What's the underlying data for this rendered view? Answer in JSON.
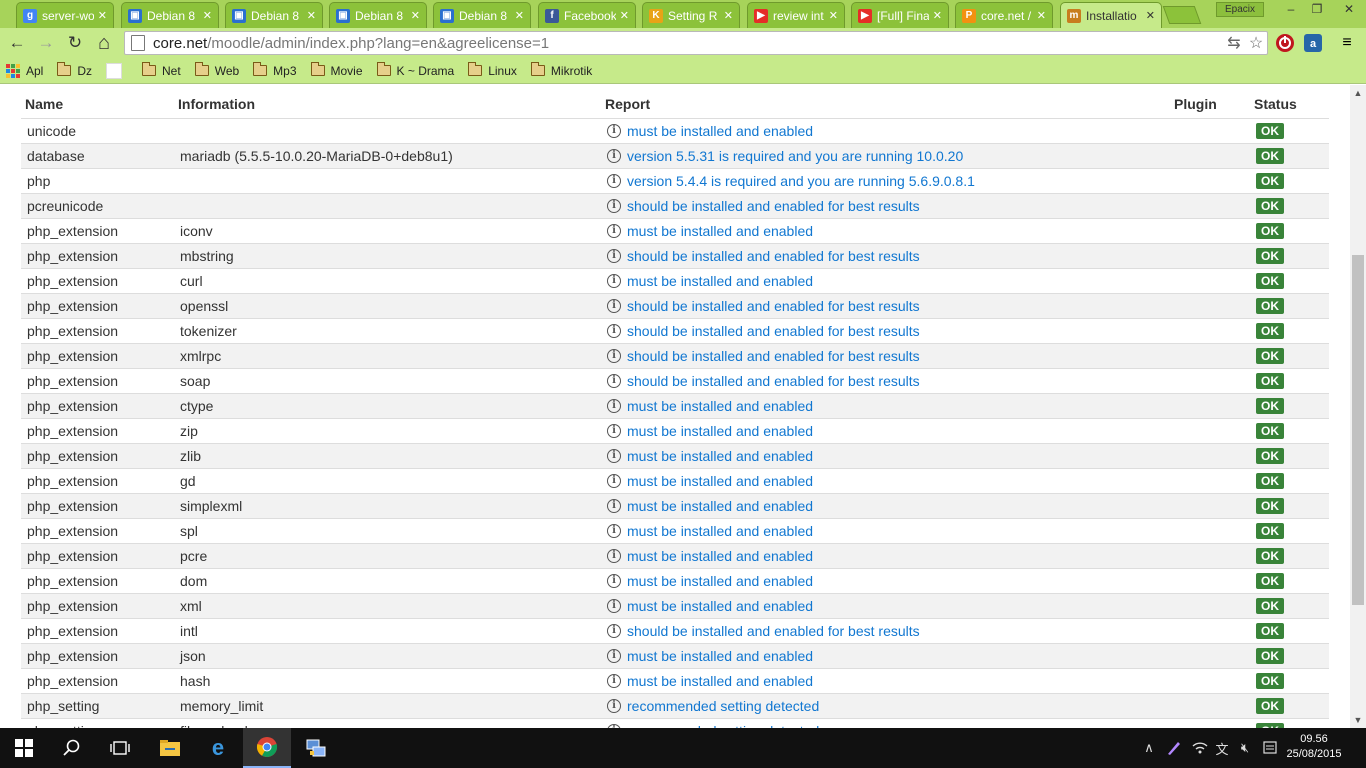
{
  "browser": {
    "tabs": [
      {
        "title": "server-wo",
        "color": "#4285f4",
        "glyph": "g"
      },
      {
        "title": "Debian 8",
        "color": "#2a6fcf",
        "glyph": "▣"
      },
      {
        "title": "Debian 8",
        "color": "#2a6fcf",
        "glyph": "▣"
      },
      {
        "title": "Debian 8",
        "color": "#2a6fcf",
        "glyph": "▣"
      },
      {
        "title": "Debian 8",
        "color": "#2a6fcf",
        "glyph": "▣"
      },
      {
        "title": "Facebook",
        "color": "#3b5998",
        "glyph": "f"
      },
      {
        "title": "Setting R",
        "color": "#e8a317",
        "glyph": "K"
      },
      {
        "title": "review int",
        "color": "#e52d27",
        "glyph": "▶"
      },
      {
        "title": "[Full] Fina",
        "color": "#e52d27",
        "glyph": "▶"
      },
      {
        "title": "core.net /",
        "color": "#f29111",
        "glyph": "P"
      },
      {
        "title": "Installatio",
        "color": "#c87d1e",
        "glyph": "m"
      }
    ],
    "profile_name": "Epacix",
    "window_controls": {
      "minimize": "–",
      "maximize": "❐",
      "close": "✕"
    },
    "nav": {
      "back": "←",
      "forward": "→",
      "reload": "↻",
      "home": "⌂"
    },
    "url_host": "core.net",
    "url_path": "/moodle/admin/index.php?lang=en&agreelicense=1",
    "bookmarks": [
      "Apl",
      "Dz",
      "",
      "Net",
      "Web",
      "Mp3",
      "Movie",
      "K ~ Drama",
      "Linux",
      "Mikrotik"
    ]
  },
  "table": {
    "headers": {
      "name": "Name",
      "information": "Information",
      "report": "Report",
      "plugin": "Plugin",
      "status": "Status"
    },
    "rows": [
      {
        "name": "unicode",
        "info": "",
        "report": "must be installed and enabled",
        "plugin": "",
        "status": "OK"
      },
      {
        "name": "database",
        "info": "mariadb (5.5.5-10.0.20-MariaDB-0+deb8u1)",
        "report": "version 5.5.31 is required and you are running 10.0.20",
        "plugin": "",
        "status": "OK"
      },
      {
        "name": "php",
        "info": "",
        "report": "version 5.4.4 is required and you are running 5.6.9.0.8.1",
        "plugin": "",
        "status": "OK"
      },
      {
        "name": "pcreunicode",
        "info": "",
        "report": "should be installed and enabled for best results",
        "plugin": "",
        "status": "OK"
      },
      {
        "name": "php_extension",
        "info": "iconv",
        "report": "must be installed and enabled",
        "plugin": "",
        "status": "OK"
      },
      {
        "name": "php_extension",
        "info": "mbstring",
        "report": "should be installed and enabled for best results",
        "plugin": "",
        "status": "OK"
      },
      {
        "name": "php_extension",
        "info": "curl",
        "report": "must be installed and enabled",
        "plugin": "",
        "status": "OK"
      },
      {
        "name": "php_extension",
        "info": "openssl",
        "report": "should be installed and enabled for best results",
        "plugin": "",
        "status": "OK"
      },
      {
        "name": "php_extension",
        "info": "tokenizer",
        "report": "should be installed and enabled for best results",
        "plugin": "",
        "status": "OK"
      },
      {
        "name": "php_extension",
        "info": "xmlrpc",
        "report": "should be installed and enabled for best results",
        "plugin": "",
        "status": "OK"
      },
      {
        "name": "php_extension",
        "info": "soap",
        "report": "should be installed and enabled for best results",
        "plugin": "",
        "status": "OK"
      },
      {
        "name": "php_extension",
        "info": "ctype",
        "report": "must be installed and enabled",
        "plugin": "",
        "status": "OK"
      },
      {
        "name": "php_extension",
        "info": "zip",
        "report": "must be installed and enabled",
        "plugin": "",
        "status": "OK"
      },
      {
        "name": "php_extension",
        "info": "zlib",
        "report": "must be installed and enabled",
        "plugin": "",
        "status": "OK"
      },
      {
        "name": "php_extension",
        "info": "gd",
        "report": "must be installed and enabled",
        "plugin": "",
        "status": "OK"
      },
      {
        "name": "php_extension",
        "info": "simplexml",
        "report": "must be installed and enabled",
        "plugin": "",
        "status": "OK"
      },
      {
        "name": "php_extension",
        "info": "spl",
        "report": "must be installed and enabled",
        "plugin": "",
        "status": "OK"
      },
      {
        "name": "php_extension",
        "info": "pcre",
        "report": "must be installed and enabled",
        "plugin": "",
        "status": "OK"
      },
      {
        "name": "php_extension",
        "info": "dom",
        "report": "must be installed and enabled",
        "plugin": "",
        "status": "OK"
      },
      {
        "name": "php_extension",
        "info": "xml",
        "report": "must be installed and enabled",
        "plugin": "",
        "status": "OK"
      },
      {
        "name": "php_extension",
        "info": "intl",
        "report": "should be installed and enabled for best results",
        "plugin": "",
        "status": "OK"
      },
      {
        "name": "php_extension",
        "info": "json",
        "report": "must be installed and enabled",
        "plugin": "",
        "status": "OK"
      },
      {
        "name": "php_extension",
        "info": "hash",
        "report": "must be installed and enabled",
        "plugin": "",
        "status": "OK"
      },
      {
        "name": "php_setting",
        "info": "memory_limit",
        "report": "recommended setting detected",
        "plugin": "",
        "status": "OK"
      },
      {
        "name": "php_setting",
        "info": "file_uploads",
        "report": "recommended setting detected",
        "plugin": "",
        "status": "OK"
      }
    ]
  },
  "taskbar": {
    "time": "09.56",
    "date": "25/08/2015"
  },
  "colors": {
    "chrome_theme": "#a7d35a",
    "link": "#1177d1",
    "ok_badge": "#398439"
  }
}
